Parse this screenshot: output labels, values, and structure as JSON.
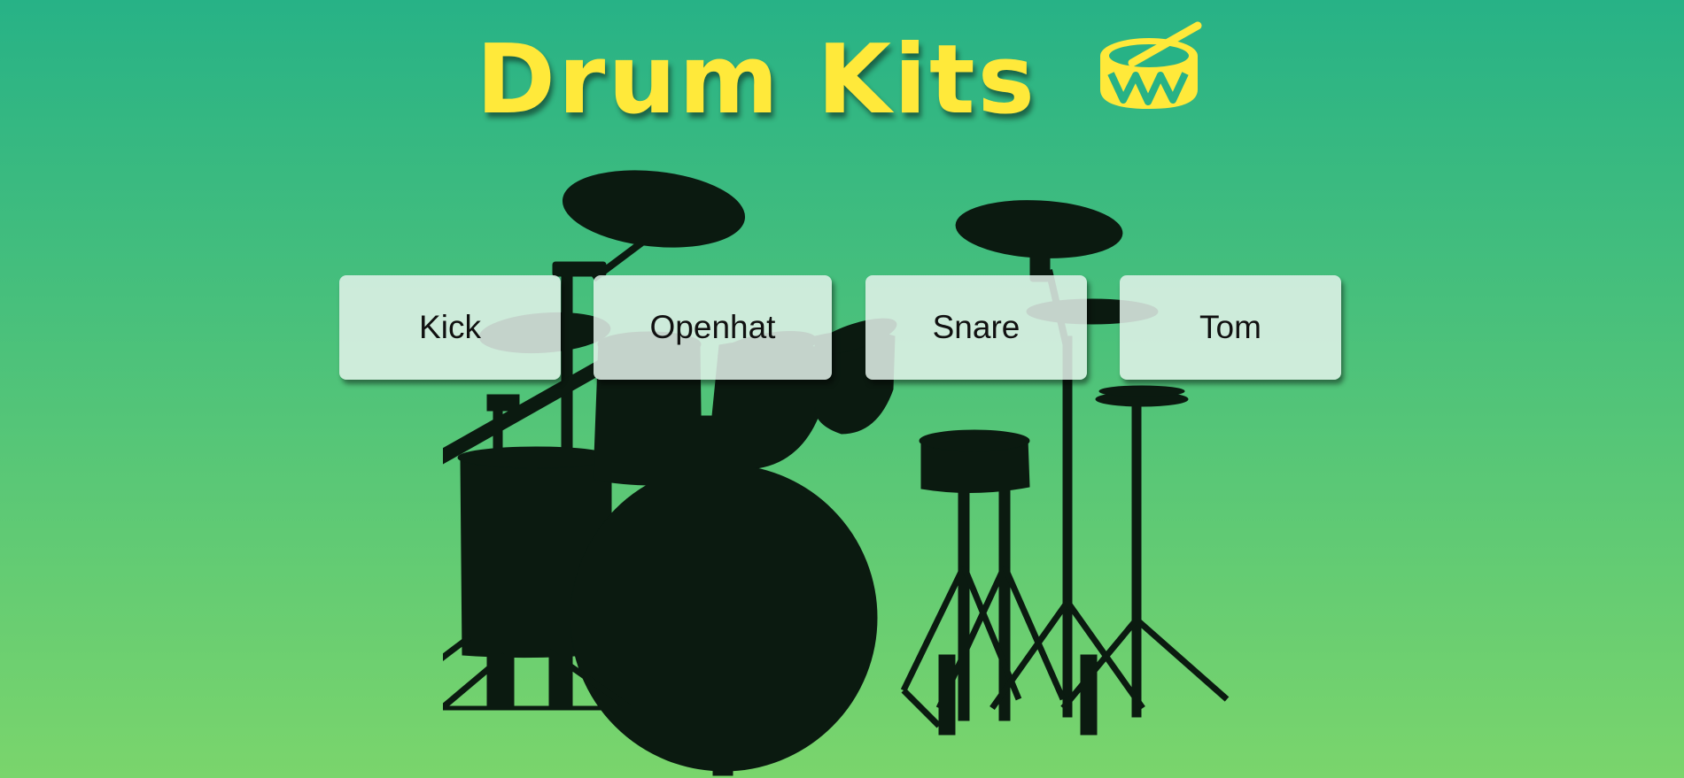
{
  "header": {
    "title": "Drum Kits",
    "icon": "drum-icon"
  },
  "drum_buttons": [
    {
      "label": "Kick"
    },
    {
      "label": "Openhat"
    },
    {
      "label": "Snare"
    },
    {
      "label": "Tom"
    }
  ],
  "background_image": "drum-kit-silhouette",
  "colors": {
    "background_top": "#27B286",
    "background_bottom": "#7AD56C",
    "title": "#FFE93A",
    "silhouette": "#0B1A10",
    "button": "#E3F2EA"
  }
}
